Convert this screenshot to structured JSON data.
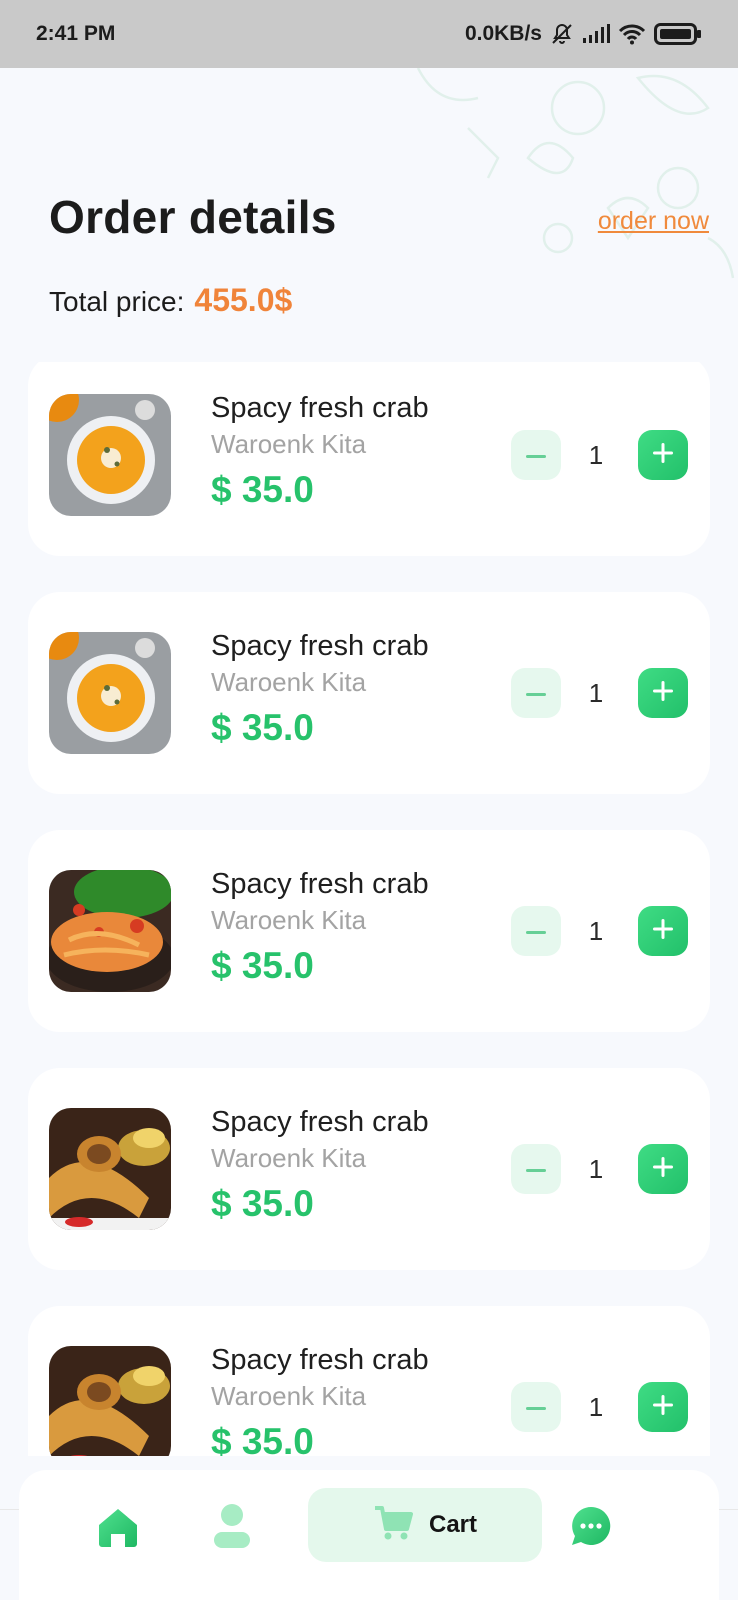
{
  "status_bar": {
    "time": "2:41 PM",
    "network_speed": "0.0KB/s",
    "icons": [
      "mute-icon",
      "signal-icon",
      "wifi-icon",
      "battery-icon"
    ]
  },
  "header": {
    "title": "Order details",
    "order_now": "order now"
  },
  "summary": {
    "total_label": "Total price:",
    "total_value": "455.0$"
  },
  "items": [
    {
      "name": "Spacy fresh crab",
      "shop": "Waroenk Kita",
      "price": "$ 35.0",
      "qty": "1",
      "image": "soup-bowl-image"
    },
    {
      "name": "Spacy fresh crab",
      "shop": "Waroenk Kita",
      "price": "$ 35.0",
      "qty": "1",
      "image": "soup-bowl-image"
    },
    {
      "name": "Spacy fresh crab",
      "shop": "Waroenk Kita",
      "price": "$ 35.0",
      "qty": "1",
      "image": "pasta-plate-image"
    },
    {
      "name": "Spacy fresh crab",
      "shop": "Waroenk Kita",
      "price": "$ 35.0",
      "qty": "1",
      "image": "rolls-plate-image"
    },
    {
      "name": "Spacy fresh crab",
      "shop": "Waroenk Kita",
      "price": "$ 35.0",
      "qty": "1",
      "image": "rolls-plate-image"
    }
  ],
  "bottom_nav": {
    "home_icon": "home-icon",
    "profile_icon": "profile-icon",
    "cart_icon": "cart-icon",
    "cart_label": "Cart",
    "chat_icon": "chat-icon"
  },
  "colors": {
    "accent_green": "#27c26b",
    "accent_orange": "#f0843a",
    "background": "#f7f9fd"
  }
}
